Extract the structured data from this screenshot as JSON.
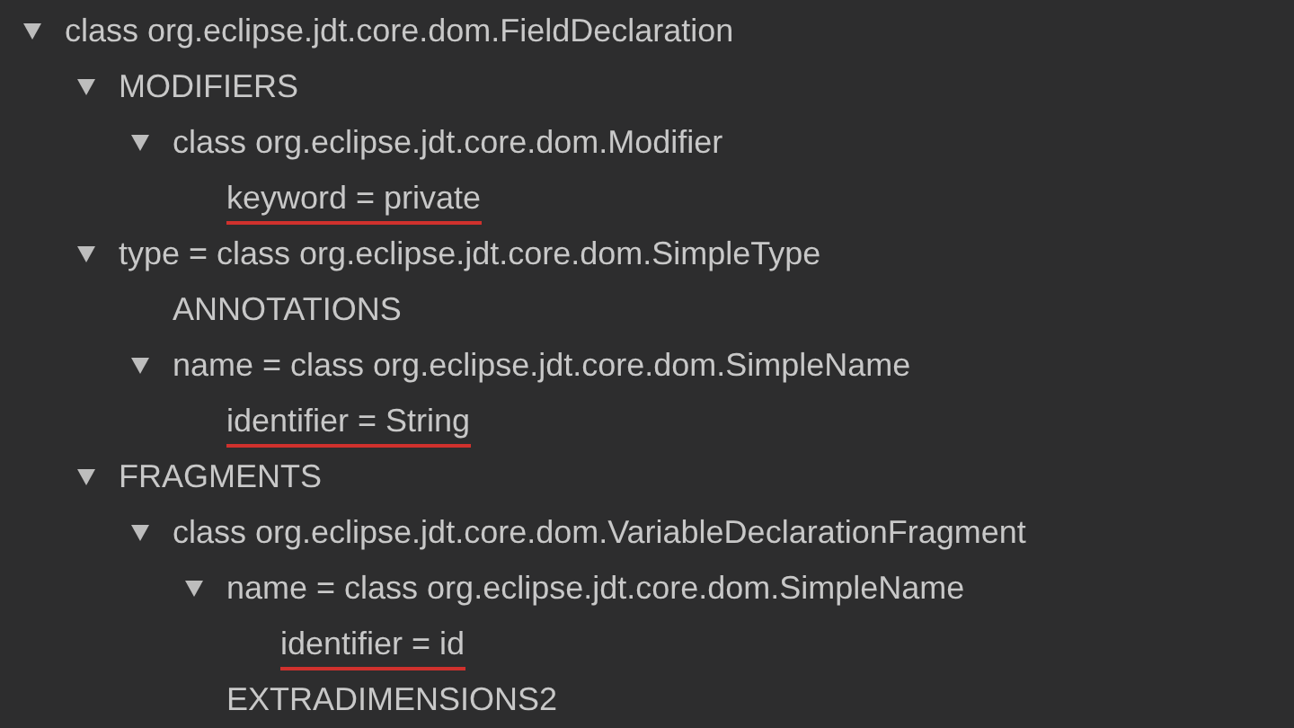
{
  "tree": [
    {
      "label": "class org.eclipse.jdt.core.dom.FieldDeclaration",
      "expanded": true,
      "children": [
        {
          "label": "MODIFIERS",
          "expanded": true,
          "children": [
            {
              "label": "class org.eclipse.jdt.core.dom.Modifier",
              "expanded": true,
              "children": [
                {
                  "label": "keyword = private",
                  "underlined": true
                }
              ]
            }
          ]
        },
        {
          "label": "type = class org.eclipse.jdt.core.dom.SimpleType",
          "expanded": true,
          "children": [
            {
              "label": "ANNOTATIONS",
              "underlined": false
            },
            {
              "label": "name = class org.eclipse.jdt.core.dom.SimpleName",
              "expanded": true,
              "children": [
                {
                  "label": "identifier = String",
                  "underlined": true
                }
              ]
            }
          ]
        },
        {
          "label": "FRAGMENTS",
          "expanded": true,
          "children": [
            {
              "label": "class org.eclipse.jdt.core.dom.VariableDeclarationFragment",
              "expanded": true,
              "children": [
                {
                  "label": "name = class org.eclipse.jdt.core.dom.SimpleName",
                  "expanded": true,
                  "children": [
                    {
                      "label": "identifier = id",
                      "underlined": true
                    }
                  ]
                },
                {
                  "label": "EXTRADIMENSIONS2",
                  "underlined": false
                }
              ]
            }
          ]
        }
      ]
    }
  ]
}
